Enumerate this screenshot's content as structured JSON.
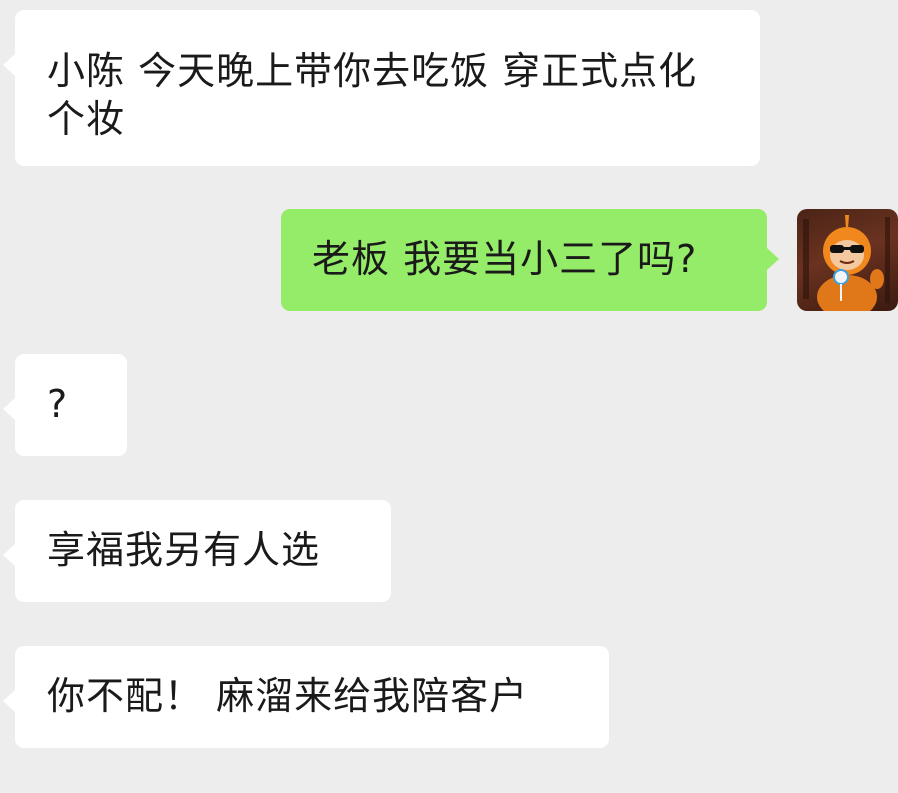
{
  "messages": [
    {
      "id": 1,
      "side": "incoming",
      "text": "小陈 今天晚上带你去吃饭 穿正式点化个妆"
    },
    {
      "id": 2,
      "side": "outgoing",
      "text": "老板 我要当小三了吗?"
    },
    {
      "id": 3,
      "side": "incoming",
      "text": "?"
    },
    {
      "id": 4,
      "side": "incoming",
      "text": "享福我另有人选"
    },
    {
      "id": 5,
      "side": "incoming",
      "text": "你不配！ 麻溜来给我陪客户"
    }
  ],
  "avatar": {
    "icon": "teletubby-sunglasses-avatar-icon"
  },
  "colors": {
    "background": "#ededed",
    "incoming_bubble": "#ffffff",
    "outgoing_bubble": "#95ec69",
    "text": "#1a1a1a"
  }
}
